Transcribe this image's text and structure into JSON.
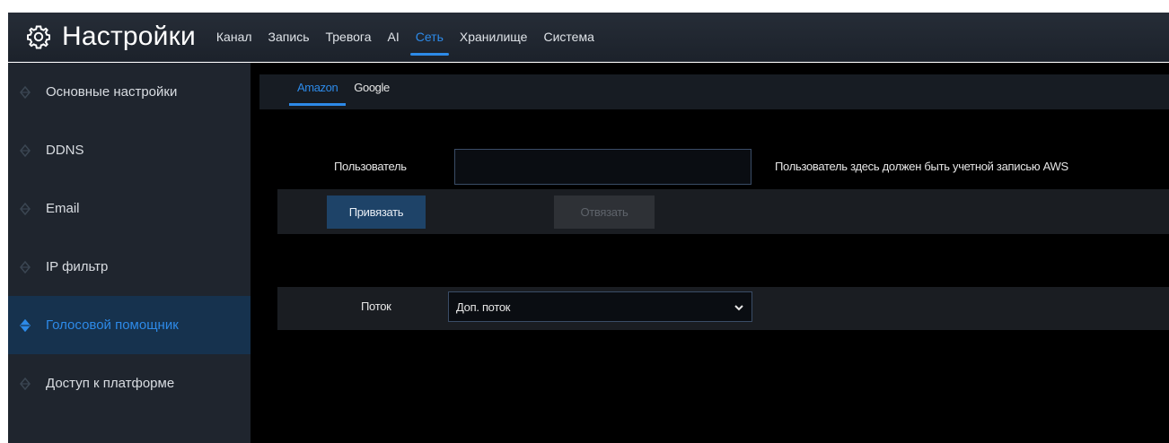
{
  "header": {
    "title": "Настройки",
    "icon": "gear-icon",
    "accent": "#2d8ae8",
    "tabs": [
      {
        "label": "Канал",
        "active": false
      },
      {
        "label": "Запись",
        "active": false
      },
      {
        "label": "Тревога",
        "active": false
      },
      {
        "label": "AI",
        "active": false
      },
      {
        "label": "Сеть",
        "active": true
      },
      {
        "label": "Хранилище",
        "active": false
      },
      {
        "label": "Система",
        "active": false
      }
    ]
  },
  "sidebar": {
    "items": [
      {
        "label": "Основные настройки",
        "active": false
      },
      {
        "label": "DDNS",
        "active": false
      },
      {
        "label": "Email",
        "active": false
      },
      {
        "label": "IP фильтр",
        "active": false
      },
      {
        "label": "Голосовой помощник",
        "active": true
      },
      {
        "label": "Доступ к платформе",
        "active": false
      }
    ]
  },
  "main": {
    "subtabs": [
      {
        "label": "Amazon",
        "active": true
      },
      {
        "label": "Google",
        "active": false
      }
    ],
    "user": {
      "label": "Пользователь",
      "value": "",
      "hint": "Пользователь здесь должен быть учетной записью AWS"
    },
    "buttons": {
      "bind": "Привязать",
      "unbind": "Отвязать"
    },
    "stream": {
      "label": "Поток",
      "selected": "Доп. поток"
    }
  }
}
